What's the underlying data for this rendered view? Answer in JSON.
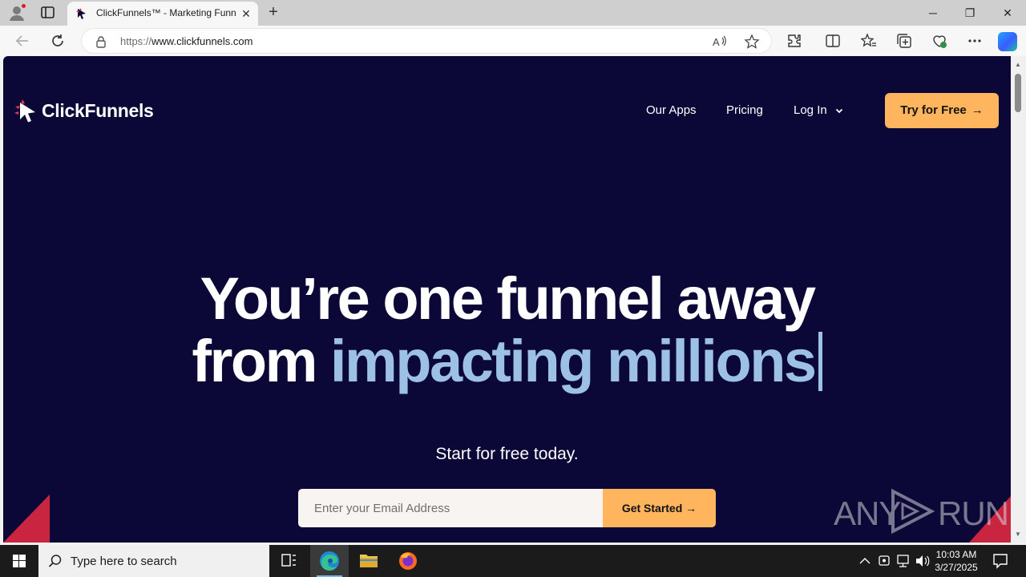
{
  "browser": {
    "tab": {
      "title": "ClickFunnels™ - Marketing Funnels",
      "favicon": "clickfunnels-favicon",
      "close_glyph": "✕"
    },
    "new_tab_glyph": "+",
    "window_controls": {
      "minimize": "─",
      "restore": "❐",
      "close": "✕"
    },
    "address": {
      "protocol": "https://",
      "host": "www.clickfunnels.com"
    },
    "icons": [
      "back-icon",
      "refresh-icon",
      "lock-icon",
      "read-aloud-icon",
      "favorite-star-icon",
      "extensions-icon",
      "split-screen-icon",
      "favorites-icon",
      "collections-icon",
      "browser-essentials-icon",
      "more-menu-icon",
      "copilot-icon"
    ]
  },
  "site": {
    "logo_text": "ClickFunnels",
    "nav": {
      "apps": "Our Apps",
      "pricing": "Pricing",
      "login": "Log In"
    },
    "cta_try": "Try for Free",
    "hero": {
      "line1": "You’re one funnel away",
      "line2_plain": "from ",
      "line2_accent": "impacting millions"
    },
    "subheading": "Start for free today.",
    "email_placeholder": "Enter your Email Address",
    "cta_get_started": "Get Started",
    "arrow_glyph": "→"
  },
  "watermark": {
    "left": "ANY",
    "right": "RUN"
  },
  "colors": {
    "page_bg": "#0b0737",
    "accent_orange": "#ffb55e",
    "hero_accent": "#9cc1e4",
    "corner_red": "#c92540"
  },
  "taskbar": {
    "search_placeholder": "Type here to search",
    "apps": [
      "task-view-icon",
      "edge-icon",
      "file-explorer-icon",
      "firefox-icon"
    ],
    "time": "10:03 AM",
    "date": "3/27/2025"
  }
}
